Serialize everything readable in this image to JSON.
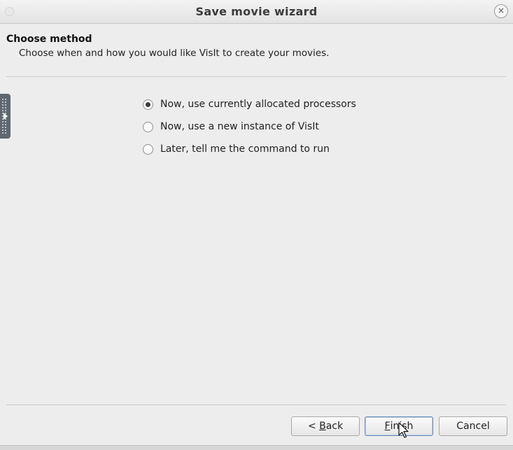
{
  "window": {
    "title": "Save movie wizard",
    "close_symbol": "×"
  },
  "page": {
    "heading": "Choose method",
    "subheading": "Choose when and how you would like VisIt to create your movies."
  },
  "options": [
    {
      "label": "Now, use currently allocated processors",
      "checked": true
    },
    {
      "label": "Now, use a new instance of VisIt",
      "checked": false
    },
    {
      "label": "Later, tell me the command to run",
      "checked": false
    }
  ],
  "buttons": {
    "back": {
      "prefix": "< ",
      "mnemonic": "B",
      "rest": "ack"
    },
    "finish": {
      "mnemonic": "F",
      "rest": "inish"
    },
    "cancel": "Cancel"
  },
  "icons": {
    "window_icon": "window-menu-icon",
    "close": "close-icon",
    "side_handle": "panel-expand-handle-icon",
    "cursor": "mouse-pointer-icon"
  }
}
